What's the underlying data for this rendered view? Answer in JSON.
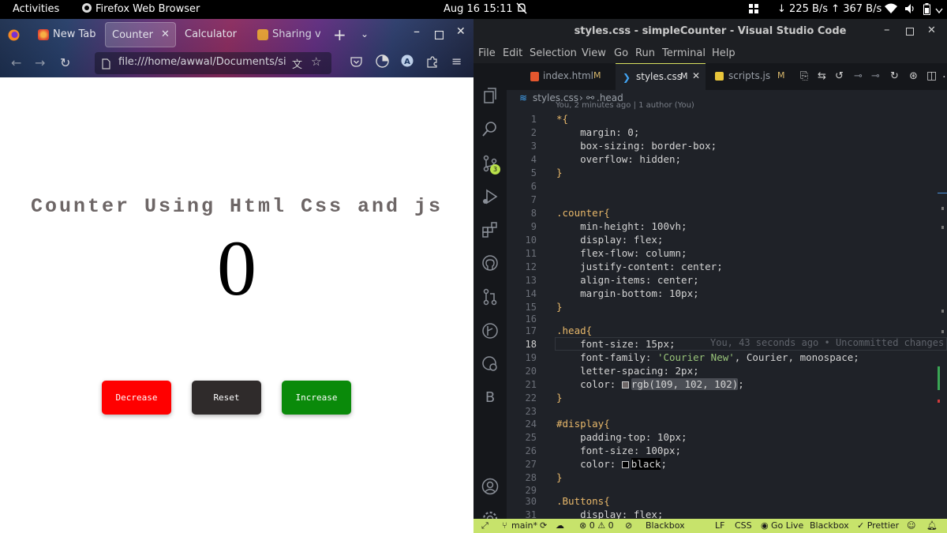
{
  "topbar": {
    "activities": "Activities",
    "app_name": "Firefox Web Browser",
    "datetime": "Aug 16  15:11",
    "net_speed": "↓ 225 B/s ↑ 367 B/s"
  },
  "firefox": {
    "tabs": [
      {
        "label": "New Tab"
      },
      {
        "label": "Counter"
      },
      {
        "label": "Calculator"
      },
      {
        "label": "Sharing v"
      }
    ],
    "url": "file:///home/awwal/Documents/sim",
    "page": {
      "heading": "Counter Using Html Css and js",
      "counter_value": "0",
      "buttons": {
        "decrease": "Decrease",
        "reset": "Reset",
        "increase": "Increase"
      }
    },
    "colors": {
      "decrease": "#ff0000",
      "reset": "#2f2b2b",
      "increase": "#0a8a0a"
    }
  },
  "vscode": {
    "title": "styles.css - simpleCounter - Visual Studio Code",
    "menu": [
      "File",
      "Edit",
      "Selection",
      "View",
      "Go",
      "Run",
      "Terminal",
      "Help"
    ],
    "source_control_badge": "3",
    "tabs": [
      {
        "label": "index.html",
        "mark": "M"
      },
      {
        "label": "styles.css",
        "mark": "M"
      },
      {
        "label": "scripts.js",
        "mark": "M"
      }
    ],
    "breadcrumb": {
      "file": "styles.css",
      "symbol": ".head"
    },
    "blame_header": "You, 2 minutes ago | 1 author (You)",
    "inline_blame": "You, 43 seconds ago • Uncommitted changes",
    "line_numbers": [
      "1",
      "2",
      "3",
      "4",
      "5",
      "6",
      "7",
      "8",
      "9",
      "10",
      "11",
      "12",
      "13",
      "14",
      "15",
      "16",
      "17",
      "18",
      "19",
      "20",
      "21",
      "22",
      "23",
      "24",
      "25",
      "26",
      "27",
      "28",
      "29",
      "30",
      "31"
    ],
    "code": {
      "l1": "*{",
      "l2": "    margin: 0;",
      "l3": "    box-sizing: border-box;",
      "l4": "    overflow: hidden;",
      "l5": "}",
      "l8": ".counter{",
      "l9": "    min-height: 100vh;",
      "l10": "    display: flex;",
      "l11": "    flex-flow: column;",
      "l12": "    justify-content: center;",
      "l13": "    align-items: center;",
      "l14": "    margin-bottom: 10px;",
      "l15": "}",
      "l17": ".head{",
      "l18": "    font-size: 15px;",
      "l19a": "    font-family: ",
      "l19b": "'Courier New'",
      "l19c": ", Courier, monospace;",
      "l20": "    letter-spacing: 2px;",
      "l21a": "    color: ",
      "l21b": "rgb(109, 102, 102)",
      "l21c": ";",
      "l22": "}",
      "l24": "#display{",
      "l25": "    padding-top: 10px;",
      "l26": "    font-size: 100px;",
      "l27a": "    color: ",
      "l27b": "black",
      "l27c": ";",
      "l28": "}",
      "l30": ".Buttons{",
      "l31": "    display: flex;"
    },
    "status": {
      "branch": "main*",
      "problems": "⊗ 0 ⚠ 0",
      "blackbox1": "Blackbox",
      "eol": "LF",
      "lang": "CSS",
      "golive": "Go Live",
      "blackbox2": "Blackbox",
      "prettier": "✓ Prettier"
    }
  }
}
